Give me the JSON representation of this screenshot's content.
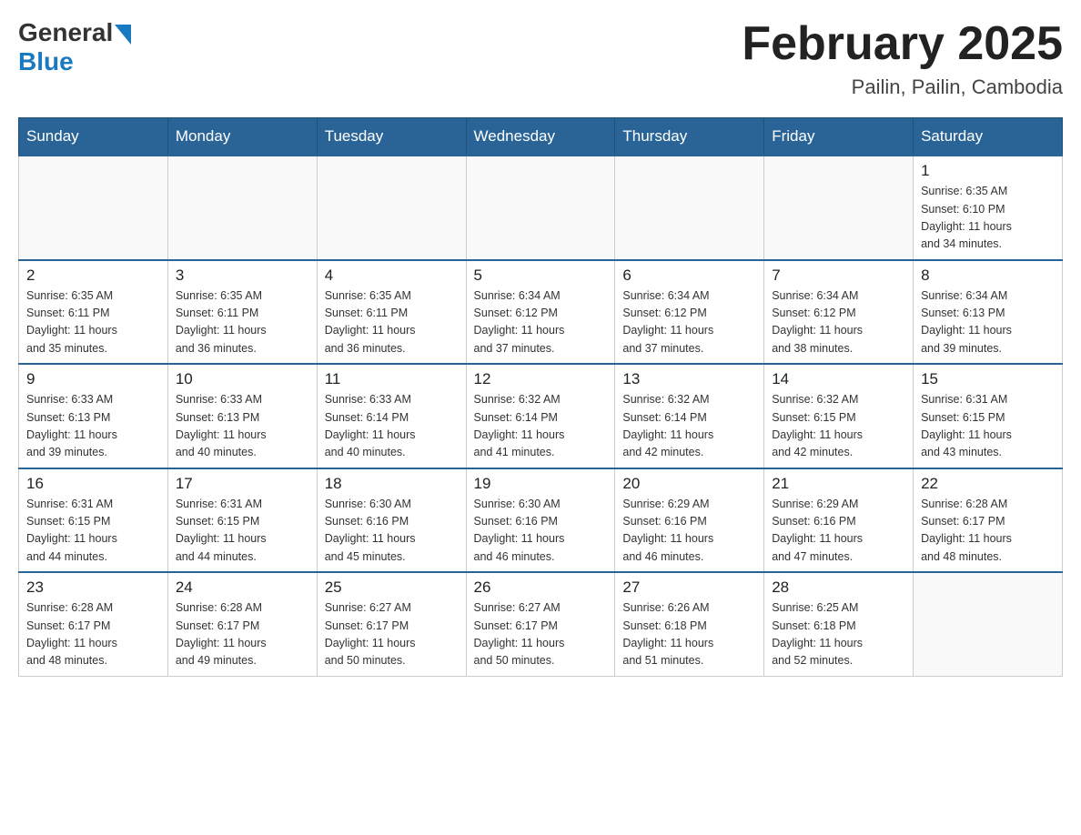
{
  "header": {
    "logo_general": "General",
    "logo_blue": "Blue",
    "month_title": "February 2025",
    "location": "Pailin, Pailin, Cambodia"
  },
  "days_of_week": [
    "Sunday",
    "Monday",
    "Tuesday",
    "Wednesday",
    "Thursday",
    "Friday",
    "Saturday"
  ],
  "weeks": [
    [
      {
        "day": "",
        "info": ""
      },
      {
        "day": "",
        "info": ""
      },
      {
        "day": "",
        "info": ""
      },
      {
        "day": "",
        "info": ""
      },
      {
        "day": "",
        "info": ""
      },
      {
        "day": "",
        "info": ""
      },
      {
        "day": "1",
        "info": "Sunrise: 6:35 AM\nSunset: 6:10 PM\nDaylight: 11 hours\nand 34 minutes."
      }
    ],
    [
      {
        "day": "2",
        "info": "Sunrise: 6:35 AM\nSunset: 6:11 PM\nDaylight: 11 hours\nand 35 minutes."
      },
      {
        "day": "3",
        "info": "Sunrise: 6:35 AM\nSunset: 6:11 PM\nDaylight: 11 hours\nand 36 minutes."
      },
      {
        "day": "4",
        "info": "Sunrise: 6:35 AM\nSunset: 6:11 PM\nDaylight: 11 hours\nand 36 minutes."
      },
      {
        "day": "5",
        "info": "Sunrise: 6:34 AM\nSunset: 6:12 PM\nDaylight: 11 hours\nand 37 minutes."
      },
      {
        "day": "6",
        "info": "Sunrise: 6:34 AM\nSunset: 6:12 PM\nDaylight: 11 hours\nand 37 minutes."
      },
      {
        "day": "7",
        "info": "Sunrise: 6:34 AM\nSunset: 6:12 PM\nDaylight: 11 hours\nand 38 minutes."
      },
      {
        "day": "8",
        "info": "Sunrise: 6:34 AM\nSunset: 6:13 PM\nDaylight: 11 hours\nand 39 minutes."
      }
    ],
    [
      {
        "day": "9",
        "info": "Sunrise: 6:33 AM\nSunset: 6:13 PM\nDaylight: 11 hours\nand 39 minutes."
      },
      {
        "day": "10",
        "info": "Sunrise: 6:33 AM\nSunset: 6:13 PM\nDaylight: 11 hours\nand 40 minutes."
      },
      {
        "day": "11",
        "info": "Sunrise: 6:33 AM\nSunset: 6:14 PM\nDaylight: 11 hours\nand 40 minutes."
      },
      {
        "day": "12",
        "info": "Sunrise: 6:32 AM\nSunset: 6:14 PM\nDaylight: 11 hours\nand 41 minutes."
      },
      {
        "day": "13",
        "info": "Sunrise: 6:32 AM\nSunset: 6:14 PM\nDaylight: 11 hours\nand 42 minutes."
      },
      {
        "day": "14",
        "info": "Sunrise: 6:32 AM\nSunset: 6:15 PM\nDaylight: 11 hours\nand 42 minutes."
      },
      {
        "day": "15",
        "info": "Sunrise: 6:31 AM\nSunset: 6:15 PM\nDaylight: 11 hours\nand 43 minutes."
      }
    ],
    [
      {
        "day": "16",
        "info": "Sunrise: 6:31 AM\nSunset: 6:15 PM\nDaylight: 11 hours\nand 44 minutes."
      },
      {
        "day": "17",
        "info": "Sunrise: 6:31 AM\nSunset: 6:15 PM\nDaylight: 11 hours\nand 44 minutes."
      },
      {
        "day": "18",
        "info": "Sunrise: 6:30 AM\nSunset: 6:16 PM\nDaylight: 11 hours\nand 45 minutes."
      },
      {
        "day": "19",
        "info": "Sunrise: 6:30 AM\nSunset: 6:16 PM\nDaylight: 11 hours\nand 46 minutes."
      },
      {
        "day": "20",
        "info": "Sunrise: 6:29 AM\nSunset: 6:16 PM\nDaylight: 11 hours\nand 46 minutes."
      },
      {
        "day": "21",
        "info": "Sunrise: 6:29 AM\nSunset: 6:16 PM\nDaylight: 11 hours\nand 47 minutes."
      },
      {
        "day": "22",
        "info": "Sunrise: 6:28 AM\nSunset: 6:17 PM\nDaylight: 11 hours\nand 48 minutes."
      }
    ],
    [
      {
        "day": "23",
        "info": "Sunrise: 6:28 AM\nSunset: 6:17 PM\nDaylight: 11 hours\nand 48 minutes."
      },
      {
        "day": "24",
        "info": "Sunrise: 6:28 AM\nSunset: 6:17 PM\nDaylight: 11 hours\nand 49 minutes."
      },
      {
        "day": "25",
        "info": "Sunrise: 6:27 AM\nSunset: 6:17 PM\nDaylight: 11 hours\nand 50 minutes."
      },
      {
        "day": "26",
        "info": "Sunrise: 6:27 AM\nSunset: 6:17 PM\nDaylight: 11 hours\nand 50 minutes."
      },
      {
        "day": "27",
        "info": "Sunrise: 6:26 AM\nSunset: 6:18 PM\nDaylight: 11 hours\nand 51 minutes."
      },
      {
        "day": "28",
        "info": "Sunrise: 6:25 AM\nSunset: 6:18 PM\nDaylight: 11 hours\nand 52 minutes."
      },
      {
        "day": "",
        "info": ""
      }
    ]
  ]
}
